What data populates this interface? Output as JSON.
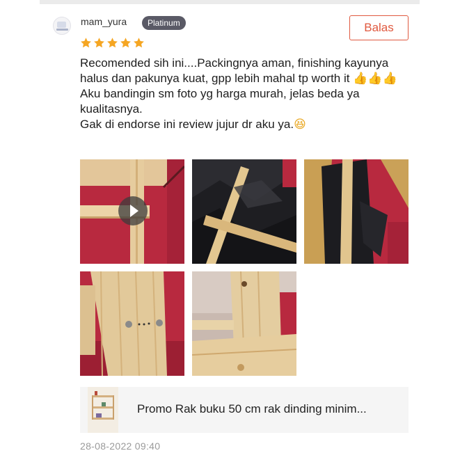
{
  "review": {
    "username": "mam_yura",
    "badge": "Platinum",
    "reply_label": "Balas",
    "rating": 5,
    "star_color": "#f5a623",
    "lines": [
      "Recomended sih ini....Packingnya aman, finishing kayunya halus dan pakunya kuat, gpp lebih mahal tp worth it",
      "Aku bandingin sm foto yg harga murah, jelas beda ya kualitasnya.",
      "Gak di endorse ini review jujur dr aku ya."
    ],
    "emoji_thumbs": "👍👍👍",
    "emoji_grin": "😆",
    "media": [
      {
        "kind": "video",
        "icon": "play-icon"
      },
      {
        "kind": "photo"
      },
      {
        "kind": "photo"
      },
      {
        "kind": "photo"
      },
      {
        "kind": "photo"
      }
    ],
    "product_name": "Promo Rak buku 50 cm rak dinding minim...",
    "timestamp": "28-08-2022 09:40"
  },
  "colors": {
    "accent": "#e0593f",
    "badge_bg": "#5a5a66",
    "timestamp": "#9a9a9a"
  }
}
